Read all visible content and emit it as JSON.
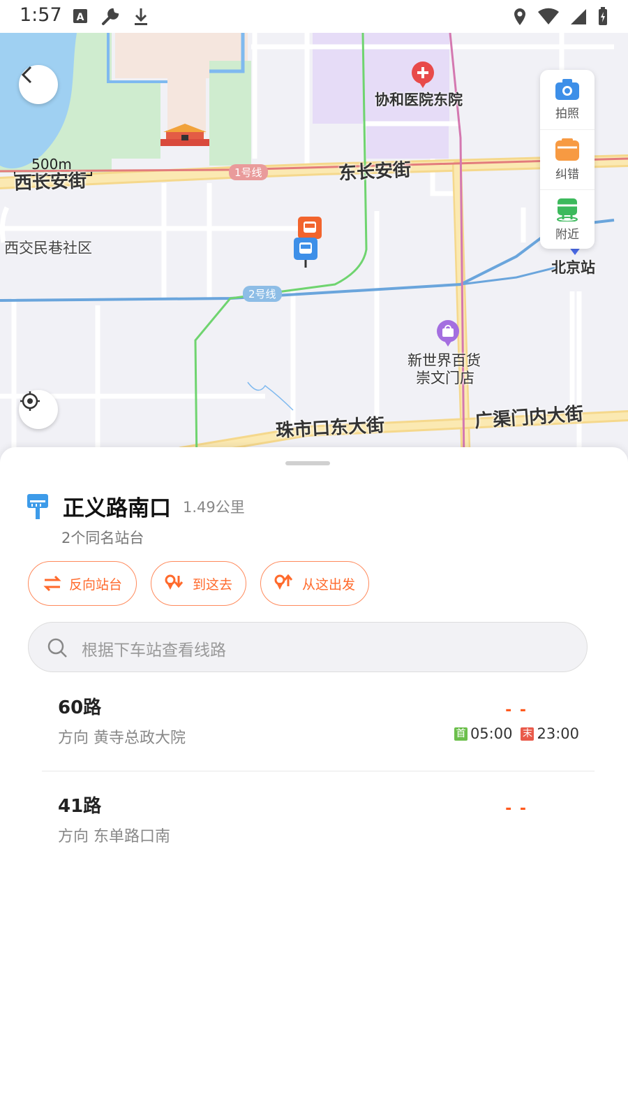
{
  "status_bar": {
    "time": "1:57"
  },
  "map": {
    "scale_label": "500m",
    "labels": {
      "hospital": "协和医院东院",
      "west_changan": "西长安街",
      "east_changan": "东长安街",
      "xijiaomin": "西交民巷社区",
      "beijing_station": "北京站",
      "mall_line1": "新世界百货",
      "mall_line2": "崇文门店",
      "zhushikou": "珠市口东大街",
      "guangqumen": "广渠门内大街",
      "line1": "1号线",
      "line2": "2号线"
    },
    "tools": [
      {
        "icon": "camera-icon",
        "label": "拍照"
      },
      {
        "icon": "correction-icon",
        "label": "纠错"
      },
      {
        "icon": "nearby-icon",
        "label": "附近"
      }
    ]
  },
  "stop": {
    "name": "正义路南口",
    "distance": "1.49公里",
    "sub": "2个同名站台"
  },
  "actions": [
    {
      "label": "反向站台"
    },
    {
      "label": "到这去"
    },
    {
      "label": "从这出发"
    }
  ],
  "search": {
    "placeholder": "根据下车站查看线路"
  },
  "routes": [
    {
      "name": "60路",
      "direction": "方向 黄寺总政大院",
      "eta": "- -",
      "first_badge": "首",
      "first_time": "05:00",
      "last_badge": "末",
      "last_time": "23:00"
    },
    {
      "name": "41路",
      "direction": "方向 东单路口南",
      "eta": "- -"
    }
  ],
  "colors": {
    "accent": "#ff6a2c",
    "line1": "#e37c7c",
    "line2": "#6aa5dc"
  }
}
